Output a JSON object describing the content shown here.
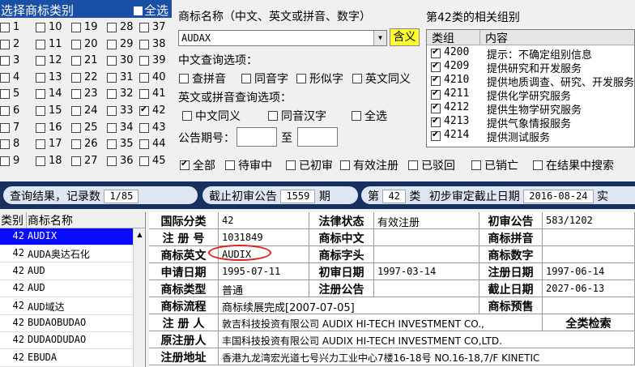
{
  "category_panel": {
    "title": "选择商标类别",
    "select_all": "全选",
    "columns": [
      [
        {
          "n": "1",
          "c": false
        },
        {
          "n": "2",
          "c": false
        },
        {
          "n": "3",
          "c": false
        },
        {
          "n": "4",
          "c": false
        },
        {
          "n": "5",
          "c": false
        },
        {
          "n": "6",
          "c": false
        },
        {
          "n": "7",
          "c": false
        },
        {
          "n": "8",
          "c": false
        },
        {
          "n": "9",
          "c": false
        }
      ],
      [
        {
          "n": "10",
          "c": false
        },
        {
          "n": "11",
          "c": false
        },
        {
          "n": "12",
          "c": false
        },
        {
          "n": "13",
          "c": false
        },
        {
          "n": "14",
          "c": false
        },
        {
          "n": "15",
          "c": false
        },
        {
          "n": "16",
          "c": false
        },
        {
          "n": "17",
          "c": false
        },
        {
          "n": "18",
          "c": false
        }
      ],
      [
        {
          "n": "19",
          "c": false
        },
        {
          "n": "20",
          "c": false
        },
        {
          "n": "21",
          "c": false
        },
        {
          "n": "22",
          "c": false
        },
        {
          "n": "23",
          "c": false
        },
        {
          "n": "24",
          "c": false
        },
        {
          "n": "25",
          "c": false
        },
        {
          "n": "26",
          "c": false
        },
        {
          "n": "27",
          "c": false
        }
      ],
      [
        {
          "n": "28",
          "c": false
        },
        {
          "n": "29",
          "c": false
        },
        {
          "n": "30",
          "c": false
        },
        {
          "n": "31",
          "c": false
        },
        {
          "n": "32",
          "c": false
        },
        {
          "n": "33",
          "c": false
        },
        {
          "n": "34",
          "c": false
        },
        {
          "n": "35",
          "c": false
        },
        {
          "n": "36",
          "c": false
        }
      ],
      [
        {
          "n": "37",
          "c": false
        },
        {
          "n": "38",
          "c": false
        },
        {
          "n": "39",
          "c": false
        },
        {
          "n": "40",
          "c": false
        },
        {
          "n": "41",
          "c": false
        },
        {
          "n": "42",
          "c": true
        },
        {
          "n": "43",
          "c": false
        },
        {
          "n": "44",
          "c": false
        },
        {
          "n": "45",
          "c": false
        }
      ]
    ]
  },
  "search": {
    "name_label": "商标名称（中文、英文或拼音、数字）",
    "name_value": "AUDAX",
    "meaning_button": "含义",
    "cn_options_label": "中文查询选项：",
    "cn_options": [
      "查拼音",
      "同音字",
      "形似字",
      "英文同义"
    ],
    "en_options_label": "英文或拼音查询选项：",
    "en_options": [
      "中文同义",
      "同音汉字",
      "全选"
    ],
    "issue_label": "公告期号：",
    "issue_to": "至"
  },
  "groups": {
    "title": "第42类的相关组别",
    "col_group": "类组",
    "col_content": "内容",
    "rows": [
      {
        "code": "4200",
        "text": "提示：不确定组别信息",
        "checked": true
      },
      {
        "code": "4209",
        "text": "提供研究和开发服务",
        "checked": true
      },
      {
        "code": "4210",
        "text": "提供地质调查、研究、开发服务",
        "checked": true
      },
      {
        "code": "4211",
        "text": "提供化学研究服务",
        "checked": true
      },
      {
        "code": "4212",
        "text": "提供生物学研究服务",
        "checked": true
      },
      {
        "code": "4213",
        "text": "提供气象情报服务",
        "checked": true
      },
      {
        "code": "4214",
        "text": "提供测试服务",
        "checked": true
      }
    ]
  },
  "status_filter": [
    {
      "label": "全部",
      "checked": true
    },
    {
      "label": "待审中",
      "checked": false
    },
    {
      "label": "已初审",
      "checked": false
    },
    {
      "label": "有效注册",
      "checked": false
    },
    {
      "label": "已驳回",
      "checked": false
    },
    {
      "label": "已销亡",
      "checked": false
    },
    {
      "label": "在结果中搜索",
      "checked": false
    }
  ],
  "result_bar": {
    "result_label": "查询结果，记录数",
    "result_count": "1/85",
    "cutoff_label": "截止初审公告",
    "cutoff_issue": "1559",
    "cutoff_suffix": "期",
    "class_prefix": "第",
    "class_value": "42",
    "class_suffix": "类",
    "date_label": "初步审定截止日期",
    "date_value": "2016-08-24",
    "date_tail": "实"
  },
  "result_table": {
    "col_class": "类别",
    "col_name": "商标名称",
    "rows": [
      {
        "cls": "42",
        "name": "AUDIX"
      },
      {
        "cls": "42",
        "name": "AUDA奥达石化"
      },
      {
        "cls": "42",
        "name": "AUD"
      },
      {
        "cls": "42",
        "name": "AUD"
      },
      {
        "cls": "42",
        "name": "AUD域达"
      },
      {
        "cls": "42",
        "name": "BUDAOBUDAO"
      },
      {
        "cls": "42",
        "name": "DUDAODUDAO"
      },
      {
        "cls": "42",
        "name": "EBUDA"
      }
    ]
  },
  "detail": {
    "intl_class_label": "国际分类",
    "intl_class_value": "42",
    "legal_status_label": "法律状态",
    "legal_status_value": "有效注册",
    "prelim_pub_label": "初审公告",
    "prelim_pub_value": "583/1202",
    "reg_no_label": "注 册 号",
    "reg_no_value": "1031849",
    "cn_name_label": "商标中文",
    "pinyin_label": "商标拼音",
    "en_name_label": "商标英文",
    "en_name_value": "AUDIX",
    "initial_label": "商标字头",
    "digit_label": "商标数字",
    "apply_date_label": "申请日期",
    "apply_date_value": "1995-07-11",
    "prelim_date_label": "初审日期",
    "prelim_date_value": "1997-03-14",
    "reg_date_label": "注册日期",
    "reg_date_value": "1997-06-14",
    "type_label": "商标类型",
    "type_value": "普通",
    "reg_pub_label": "注册公告",
    "expiry_label": "截止日期",
    "expiry_value": "2027-06-13",
    "flow_label": "商标流程",
    "flow_value": "商标续展完成[2007-07-05]",
    "preview_label": "商标预售",
    "registrant_label": "注 册 人",
    "registrant_value": "敦吉科技投资有限公司 AUDIX HI-TECH INVESTMENT CO.,",
    "full_search_label": "全类检索",
    "orig_registrant_label": "原注册人",
    "orig_registrant_value": "丰国科技投资有限公司 AUDIX HI-TECH INVESTMENT CO,LTD.",
    "address_label": "注册地址",
    "address_value": "香港九龙湾宏光道七号兴力工业中心7楼16-18号 NO.16-18,7/F KINETIC"
  },
  "colors": {
    "header_blue": "#1a4fa6",
    "bar_navy": "#17305f",
    "selected_row": "#0a0aff",
    "meaning_button": "#ffff33",
    "highlight_oval": "#e02020"
  }
}
